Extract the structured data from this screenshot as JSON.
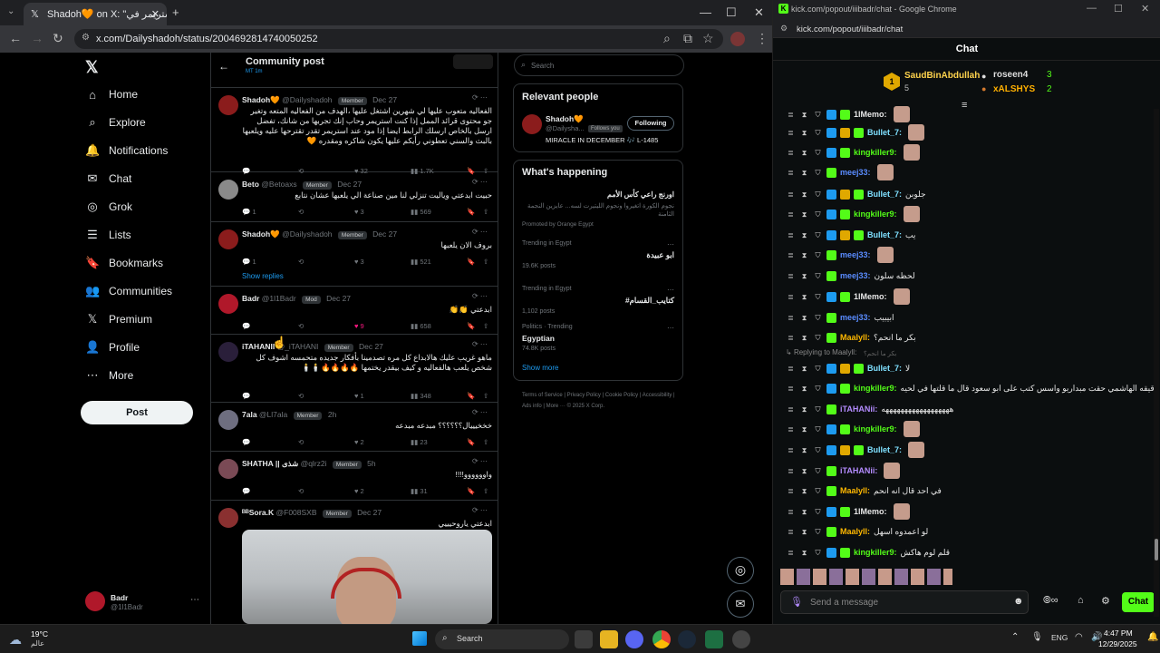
{
  "browser_left": {
    "tab_title": "Shadoh🧡 on X: \"شاهد جي استريمر في",
    "url": "x.com/Dailyshadoh/status/2004692814740050252",
    "controls": {
      "minimize": "—",
      "maximize": "☐",
      "close": "✕"
    }
  },
  "x_nav": {
    "logo": "𝕏",
    "items": [
      {
        "label": "Home",
        "icon": "home-icon",
        "glyph": "⌂"
      },
      {
        "label": "Explore",
        "icon": "search-icon",
        "glyph": "⌕"
      },
      {
        "label": "Notifications",
        "icon": "bell-icon",
        "glyph": "🔔"
      },
      {
        "label": "Chat",
        "icon": "mail-icon",
        "glyph": "✉"
      },
      {
        "label": "Grok",
        "icon": "grok-icon",
        "glyph": "◎"
      },
      {
        "label": "Lists",
        "icon": "list-icon",
        "glyph": "☰"
      },
      {
        "label": "Bookmarks",
        "icon": "bookmark-icon",
        "glyph": "🔖"
      },
      {
        "label": "Communities",
        "icon": "people-icon",
        "glyph": "👥"
      },
      {
        "label": "Premium",
        "icon": "x-icon",
        "glyph": "𝕏"
      },
      {
        "label": "Profile",
        "icon": "person-icon",
        "glyph": "👤"
      },
      {
        "label": "More",
        "icon": "more-icon",
        "glyph": "⋯"
      }
    ],
    "post_label": "Post",
    "account": {
      "name": "Badr",
      "handle": "@1l1Badr"
    }
  },
  "feed": {
    "header_title": "Community post",
    "header_sub": "MT 1m",
    "posts": [
      {
        "name": "Shadoh🧡",
        "handle": "@Dailyshadoh",
        "badge": "Member",
        "date": "Dec 27",
        "text": "الفعاليه متعوب عليها لي شهرين اشتغل عليها ،الهدف من الفعاليه المتعه وتغير جو محتوى قرائد الممل إذا كنت استريمر وحاب إنك تجربها من شانك، تفضل ارسل بالخاص ارسلك الرابط ايضا إذا مود عند استريمر تقدر تقترحها عليه ويلعبها بالبث والسني تعطوني رأيكم عليها يكون شاكره ومقدره 🧡",
        "replies": "",
        "reposts": "",
        "likes": "32",
        "views": "1.7K",
        "avatar_color": "#8b1c1c"
      },
      {
        "name": "Beto",
        "handle": "@Betoaxs",
        "badge": "Member",
        "date": "Dec 27",
        "text": "حبيت ابدعتي وياليت تنزلي لنا مين صناعة الي يلعبها عشان نتابع",
        "replies": "1",
        "reposts": "",
        "likes": "3",
        "views": "569",
        "avatar_color": "#8a8a8a"
      },
      {
        "name": "Shadoh🧡",
        "handle": "@Dailyshadoh",
        "badge": "Member",
        "date": "Dec 27",
        "text": "بروف الان يلعبها",
        "replies": "1",
        "reposts": "",
        "likes": "3",
        "views": "521",
        "avatar_color": "#8b1c1c",
        "show_replies": "Show replies"
      },
      {
        "name": "Badr",
        "handle": "@1l1Badr",
        "badge": "Mod",
        "date": "Dec 27",
        "text": "ابدعتي 👏👏",
        "replies": "",
        "reposts": "",
        "likes": "9",
        "views": "658",
        "avatar_color": "#b0182a"
      },
      {
        "name": "iTAHANII",
        "handle": "@_iTAHANI",
        "badge": "Member",
        "date": "Dec 27",
        "text": "ماهو غريب عليك هالابداع كل مره تصدمينا بأفكار جديده متحمسه اشوف كل شخص يلعب هالفعاليه و كيف بيقدر يختمها 🔥🔥🔥🔥🕯️🕯️",
        "replies": "",
        "reposts": "",
        "likes": "1",
        "views": "348",
        "avatar_color": "#2a1f3a"
      },
      {
        "name": "7ala",
        "handle": "@Ll7ala",
        "badge": "Member",
        "date": "2h",
        "text": "خخخيييال؟؟؟؟؟؟ مبدعه مبدعه",
        "replies": "",
        "reposts": "",
        "likes": "2",
        "views": "23",
        "avatar_color": "#6e6e80"
      },
      {
        "name": "SHATHA || شذى",
        "handle": "@qlrz2i",
        "badge": "Member",
        "date": "5h",
        "text": "واوووووو!!!!",
        "replies": "",
        "reposts": "",
        "likes": "2",
        "views": "31",
        "avatar_color": "#7a4a55"
      },
      {
        "name": "ᴮᴮSora.K",
        "handle": "@F008SXB",
        "badge": "Member",
        "date": "Dec 27",
        "text": "ابدعتي ياروحيييي",
        "avatar_color": "#8a3030"
      }
    ]
  },
  "right_col": {
    "search_placeholder": "Search",
    "relevant_title": "Relevant people",
    "person": {
      "name": "Shadoh🧡",
      "handle": "@Dailysha...",
      "follows_you": "Follows you",
      "bio": "MIRACLE IN DECEMBER 🎶 L-1485",
      "follow_label": "Following"
    },
    "happening_title": "What's happening",
    "promo": {
      "title": "اورنج راعي كأس الأمم",
      "sub": "نجوم الكورة اتغيروا ونجوم الليتيرت لسه... عايزين النجمة الثامنة",
      "tag": "Promoted by Orange Egypt"
    },
    "trends": [
      {
        "ctx": "Trending in Egypt",
        "name": "ابو عبيدة",
        "count": "19.6K posts"
      },
      {
        "ctx": "Trending in Egypt",
        "name": "#كتايب_القسام",
        "count": "1,102 posts"
      },
      {
        "ctx": "Politics · Trending",
        "name": "Egyptian",
        "count": "74.8K posts"
      }
    ],
    "show_more": "Show more",
    "footer": "Terms of Service | Privacy Policy | Cookie Policy | Accessibility | Ads info | More ··· © 2025 X Corp."
  },
  "browser_right": {
    "window_title": "kick.com/popout/iiibadr/chat - Google Chrome",
    "url": "kick.com/popout/iiibadr/chat",
    "chat_title": "Chat",
    "leaderboard": [
      {
        "rank": "1",
        "name": "SaudBinAbdullah",
        "count": "5"
      },
      {
        "rank": "",
        "name": "roseen4",
        "count": "3"
      },
      {
        "rank": "",
        "name": "xALSHYS",
        "count": "2"
      }
    ],
    "messages": [
      {
        "user": "1lMemo:",
        "text": "",
        "color": "#e8e8e8"
      },
      {
        "user": "Bullet_7:",
        "text": "",
        "color": "#7fe0ff"
      },
      {
        "user": "kingkiller9:",
        "text": "",
        "color": "#53fc18"
      },
      {
        "user": "meej33:",
        "text": "",
        "color": "#5a8cff"
      },
      {
        "user": "Bullet_7:",
        "text": "جلوبن",
        "color": "#7fe0ff"
      },
      {
        "user": "kingkiller9:",
        "text": "",
        "color": "#53fc18"
      },
      {
        "user": "Bullet_7:",
        "text": "يب",
        "color": "#7fe0ff"
      },
      {
        "user": "meej33:",
        "text": "",
        "color": "#5a8cff"
      },
      {
        "user": "meej33:",
        "text": "لحظه سلون",
        "color": "#5a8cff"
      },
      {
        "user": "1lMemo:",
        "text": "",
        "color": "#e8e8e8"
      },
      {
        "user": "meej33:",
        "text": "ابيبيب",
        "color": "#5a8cff"
      },
      {
        "user": "Maalyll:",
        "text": "بكر ما انحم؟",
        "color": "#ffb800"
      },
      {
        "user": "Bullet_7:",
        "text": "لا",
        "color": "#7fe0ff"
      },
      {
        "user": "kingkiller9:",
        "text": "دقيقه الهاشمي حقت مبداريو واسس كتب على ابو سعود قال ما قلتها في لحيه",
        "color": "#53fc18"
      },
      {
        "user": "iTAHANii:",
        "text": "ههههههههههههههههههه",
        "color": "#b48cff"
      },
      {
        "user": "kingkiller9:",
        "text": "",
        "color": "#53fc18"
      },
      {
        "user": "Bullet_7:",
        "text": "",
        "color": "#7fe0ff"
      },
      {
        "user": "iTAHANii:",
        "text": "",
        "color": "#b48cff"
      },
      {
        "user": "Maalyll:",
        "text": "في احد قال انه انحم",
        "color": "#ffb800"
      },
      {
        "user": "1lMemo:",
        "text": "",
        "color": "#e8e8e8"
      },
      {
        "user": "Maalyll:",
        "text": "لو اعمدوه اسهل",
        "color": "#ffb800"
      },
      {
        "user": "kingkiller9:",
        "text": "قلم لوم هاكش",
        "color": "#53fc18"
      }
    ],
    "reply_hint": "Replying to Maalyll:",
    "reply_quote": "بكر ما انحم؟",
    "send_placeholder": "Send a message",
    "chat_button": "Chat",
    "accent": "#53fc18"
  },
  "taskbar": {
    "weather_temp": "19°C",
    "weather_label": "عالم",
    "search_label": "Search",
    "lang": "ENG",
    "time": "4:47 PM",
    "date": "12/29/2025"
  }
}
